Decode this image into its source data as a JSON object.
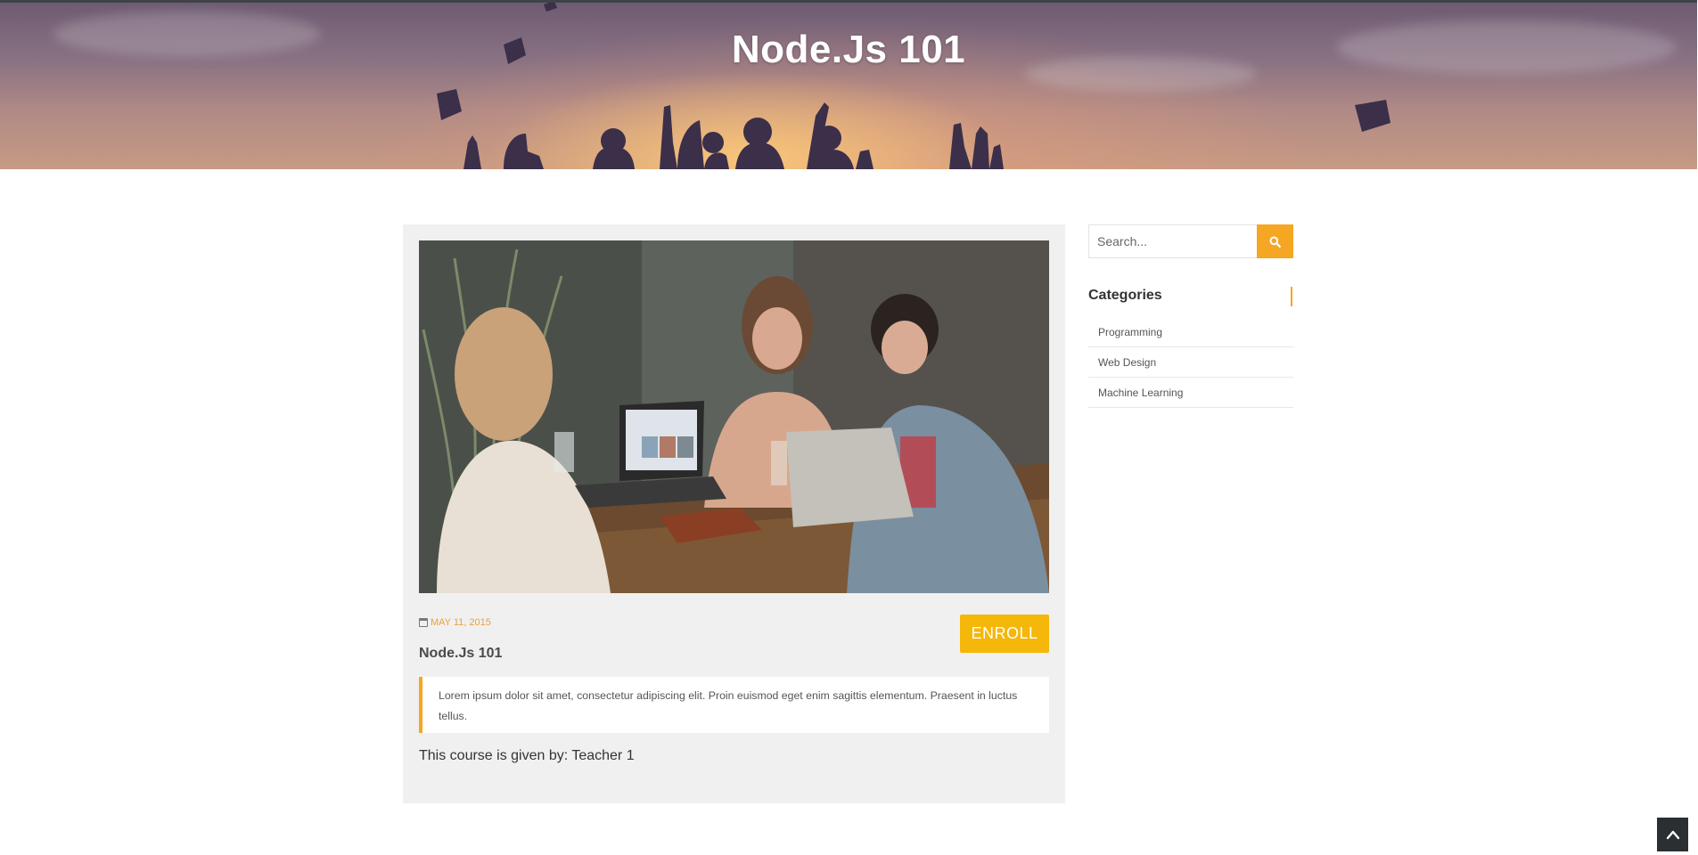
{
  "hero": {
    "title": "Node.Js 101"
  },
  "post": {
    "date": "MAY 11, 2015",
    "title": "Node.Js 101",
    "enroll_label": "ENROLL",
    "excerpt": "Lorem ipsum dolor sit amet, consectetur adipiscing elit. Proin euismod eget enim sagittis elementum. Praesent in luctus tellus.",
    "teacher_line": "This course is given by: Teacher 1"
  },
  "sidebar": {
    "search_placeholder": "Search...",
    "categories_heading": "Categories",
    "categories": [
      {
        "label": "Programming"
      },
      {
        "label": "Web Design"
      },
      {
        "label": "Machine Learning"
      }
    ]
  },
  "icons": {
    "search": "search-icon",
    "calendar": "calendar-icon",
    "back_to_top": "chevron-up-icon"
  },
  "colors": {
    "accent": "#f5a623",
    "enroll": "#f5b70a",
    "card_bg": "#f0f0f0",
    "back_to_top_bg": "#2b2f33"
  }
}
